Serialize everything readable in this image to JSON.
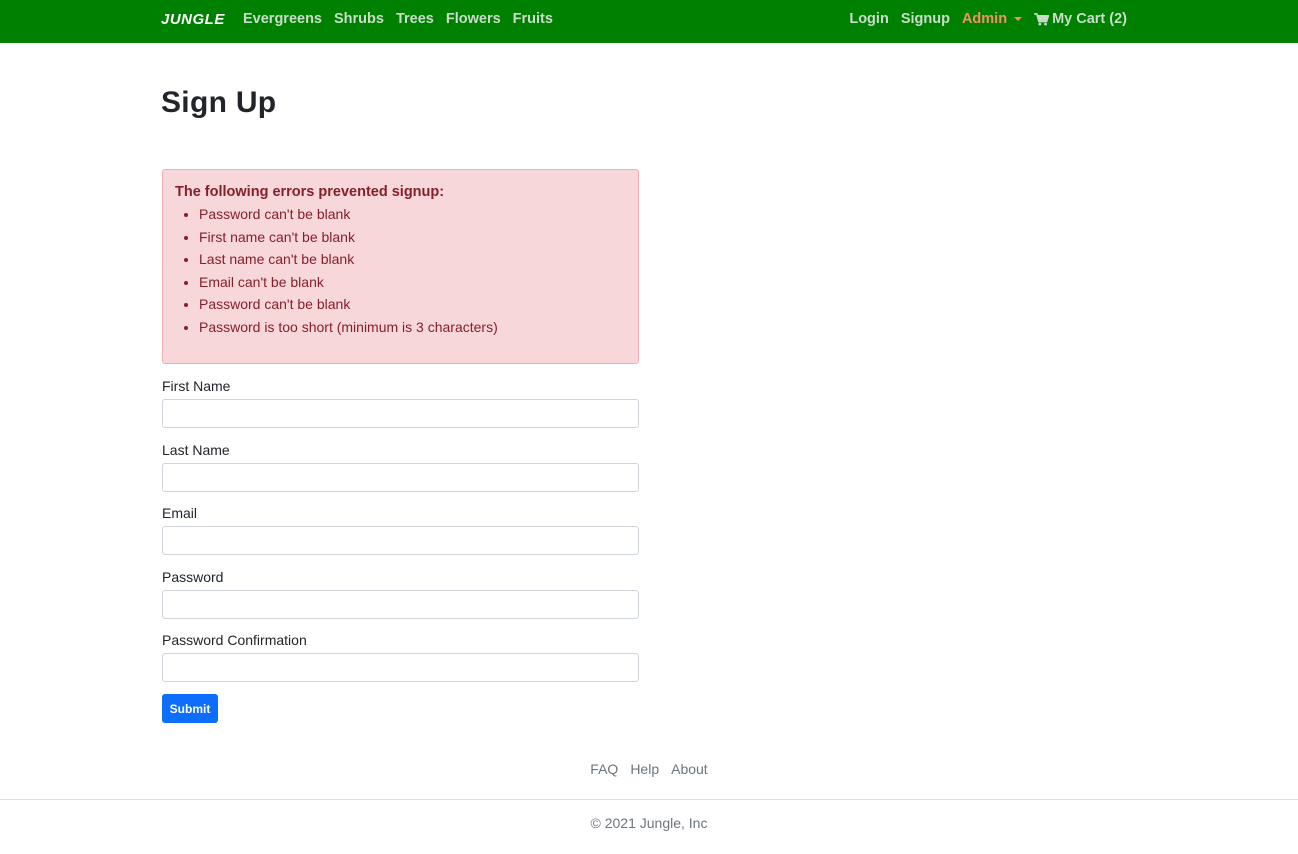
{
  "navbar": {
    "brand": "JUNGLE",
    "categories": [
      "Evergreens",
      "Shrubs",
      "Trees",
      "Flowers",
      "Fruits"
    ],
    "login": "Login",
    "signup": "Signup",
    "admin": "Admin",
    "cart": "My Cart (2)",
    "colors": {
      "background": "#008000",
      "link": "#c9dcc9",
      "admin": "#f0906a"
    }
  },
  "page": {
    "title": "Sign Up"
  },
  "errors": {
    "title": "The following errors prevented signup:",
    "items": [
      "Password can't be blank",
      "First name can't be blank",
      "Last name can't be blank",
      "Email can't be blank",
      "Password can't be blank",
      "Password is too short (minimum is 3 characters)"
    ]
  },
  "form": {
    "first_name": {
      "label": "First Name",
      "value": ""
    },
    "last_name": {
      "label": "Last Name",
      "value": ""
    },
    "email": {
      "label": "Email",
      "value": ""
    },
    "password": {
      "label": "Password",
      "value": ""
    },
    "password_confirmation": {
      "label": "Password Confirmation",
      "value": ""
    },
    "submit": "Submit"
  },
  "footer": {
    "links": [
      "FAQ",
      "Help",
      "About"
    ],
    "copyright": "© 2021 Jungle, Inc"
  }
}
